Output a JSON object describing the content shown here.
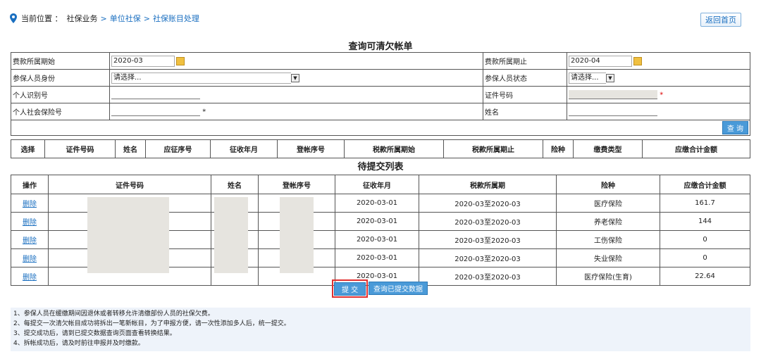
{
  "breadcrumb": {
    "label": "当前位置 ：",
    "root": "社保业务",
    "items": [
      "单位社保",
      "社保账目处理"
    ],
    "sep": ">"
  },
  "home_button": "返回首页",
  "title_query": "查询可清欠帐单",
  "form": {
    "fee_start_label": "费款所属期始",
    "fee_start_value": "2020-03",
    "fee_end_label": "费款所属期止",
    "fee_end_value": "2020-04",
    "identity_label": "参保人员身份",
    "identity_value": "请选择...",
    "status_label": "参保人员状态",
    "status_value": "请选择...",
    "personal_id_label": "个人识别号",
    "cert_label": "证件号码",
    "social_label": "个人社会保险号",
    "name_label": "姓名",
    "required_mark": "*",
    "query_button": "查 询"
  },
  "query_headers": [
    "选择",
    "证件号码",
    "姓名",
    "应征序号",
    "征收年月",
    "登帐序号",
    "税款所属期始",
    "税款所属期止",
    "险种",
    "缴费类型",
    "应缴合计金额"
  ],
  "title_pending": "待提交列表",
  "pending_headers": [
    "操作",
    "证件号码",
    "姓名",
    "登帐序号",
    "征收年月",
    "税款所属期",
    "险种",
    "应缴合计金额"
  ],
  "pending_rows": [
    {
      "op": "删除",
      "month": "2020-03-01",
      "period": "2020-03至2020-03",
      "type": "医疗保险",
      "amount": "161.7"
    },
    {
      "op": "删除",
      "month": "2020-03-01",
      "period": "2020-03至2020-03",
      "type": "养老保险",
      "amount": "144"
    },
    {
      "op": "删除",
      "month": "2020-03-01",
      "period": "2020-03至2020-03",
      "type": "工伤保险",
      "amount": "0"
    },
    {
      "op": "删除",
      "month": "2020-03-01",
      "period": "2020-03至2020-03",
      "type": "失业保险",
      "amount": "0"
    },
    {
      "op": "删除",
      "month": "2020-03-01",
      "period": "2020-03至2020-03",
      "type": "医疗保险(生育)",
      "amount": "22.64"
    }
  ],
  "submit_button": "提 交",
  "query_submitted_button": "查询已提交数据",
  "notes": [
    "1、参保人员在缓缴期间因退休或者转移允许清缴部份人员的社保欠费。",
    "2、每提交一次清欠帐目成功将拆出一笔新帐目，为了申报方便，请一次性添加多人后，统一提交。",
    "3、提交成功后，请到已提交数据查询页面查看转换结果。",
    "4、拆帐成功后，请及时前往申报并及时缴款。"
  ],
  "colors": {
    "link": "#1a6fc0",
    "button": "#4a9ad8",
    "highlight": "#e03030",
    "notes_bg": "#eef3fa"
  }
}
